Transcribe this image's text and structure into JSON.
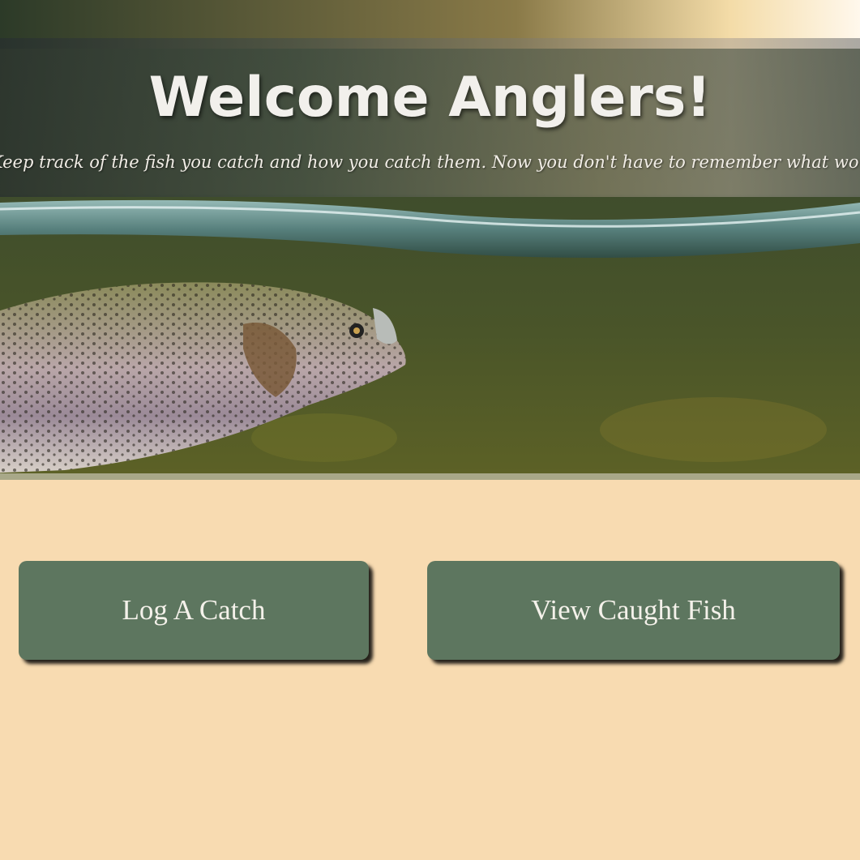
{
  "header": {
    "title": "Welcome Anglers!",
    "subtitle": "Keep track of the fish you catch and how you catch them. Now you don't have to remember what worked last time!"
  },
  "actions": {
    "log_catch_label": "Log A Catch",
    "view_fish_label": "View Caught Fish"
  },
  "colors": {
    "page_background": "#f8dbb1",
    "button_background": "#5d765f",
    "button_text": "#f4f1ea"
  }
}
